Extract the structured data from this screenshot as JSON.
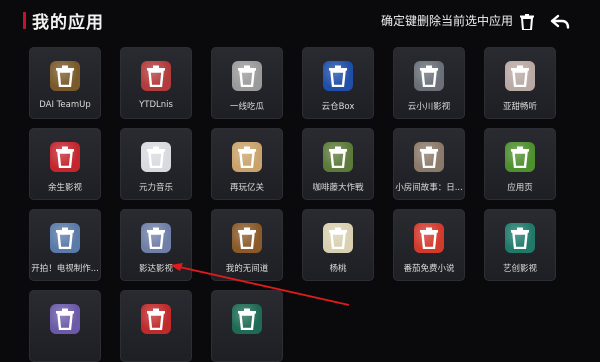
{
  "header": {
    "title": "我的应用",
    "hint": "确定键删除当前选中应用",
    "trash_icon": "trash-icon",
    "back_icon": "back-arrow-icon"
  },
  "apps": [
    {
      "label": "DAI TeamUp",
      "color": "#7a5a2a"
    },
    {
      "label": "YTDLnis",
      "color": "#b23b3b"
    },
    {
      "label": "一线吃瓜",
      "color": "#9a9a9a"
    },
    {
      "label": "云仓Box",
      "color": "#1f4fa8"
    },
    {
      "label": "云小川影视",
      "color": "#6a6f78"
    },
    {
      "label": "亚甜畅听",
      "color": "#b9a9a4"
    },
    {
      "label": "余生影视",
      "color": "#c4262e"
    },
    {
      "label": "元力音乐",
      "color": "#d8dadf"
    },
    {
      "label": "再玩亿关",
      "color": "#c9a36b"
    },
    {
      "label": "咖啡藤大作戰",
      "color": "#5c7a3a"
    },
    {
      "label": "小房间故事：日...",
      "color": "#8a7a6a"
    },
    {
      "label": "应用页",
      "color": "#4e8f2e"
    },
    {
      "label": "开拍！电视制作...",
      "color": "#5a7aa8"
    },
    {
      "label": "影达影视",
      "color": "#6f7fa8"
    },
    {
      "label": "我的无间道",
      "color": "#8a5a2a"
    },
    {
      "label": "杨桃",
      "color": "#d8d0b0"
    },
    {
      "label": "番茄免费小说",
      "color": "#d23a2c"
    },
    {
      "label": "艺创影视",
      "color": "#1f7a6a"
    },
    {
      "label": "",
      "color": "#6a5aa8"
    },
    {
      "label": "",
      "color": "#c02a2a"
    },
    {
      "label": "",
      "color": "#1e6a54"
    }
  ]
}
